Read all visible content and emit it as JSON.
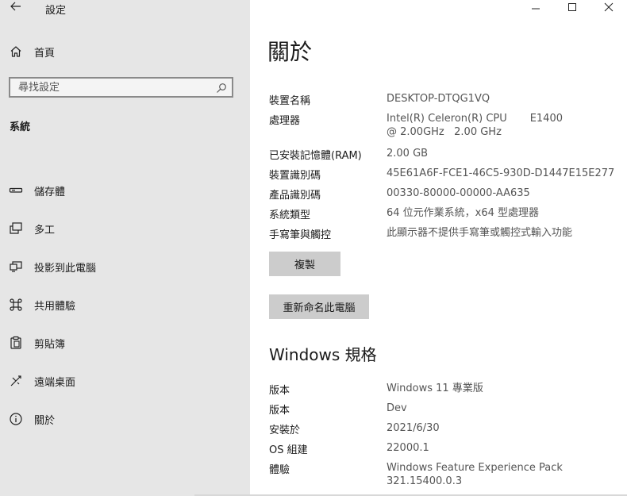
{
  "app": {
    "title": "設定"
  },
  "sidebar": {
    "home_label": "首頁",
    "search_placeholder": "尋找設定",
    "section_title": "系統",
    "items": [
      {
        "label": "儲存體",
        "icon": "storage-icon"
      },
      {
        "label": "多工",
        "icon": "multitasking-icon"
      },
      {
        "label": "投影到此電腦",
        "icon": "projecting-icon"
      },
      {
        "label": "共用體驗",
        "icon": "shared-experiences-icon"
      },
      {
        "label": "剪貼簿",
        "icon": "clipboard-icon"
      },
      {
        "label": "遠端桌面",
        "icon": "remote-desktop-icon"
      },
      {
        "label": "關於",
        "icon": "info-icon"
      }
    ]
  },
  "main": {
    "title": "關於",
    "device_specs": [
      {
        "label": "裝置名稱",
        "value": "DESKTOP-DTQG1VQ"
      },
      {
        "label": "處理器",
        "value": "Intel(R) Celeron(R) CPU       E1400  @ 2.00GHz   2.00 GHz"
      },
      {
        "label": "已安裝記憶體(RAM)",
        "value": "2.00 GB"
      },
      {
        "label": "裝置識別碼",
        "value": "45E61A6F-FCE1-46C5-930D-D1447E15E277"
      },
      {
        "label": "產品識別碼",
        "value": "00330-80000-00000-AA635"
      },
      {
        "label": "系統類型",
        "value": "64 位元作業系統，x64 型處理器"
      },
      {
        "label": "手寫筆與觸控",
        "value": "此顯示器不提供手寫筆或觸控式輸入功能"
      }
    ],
    "copy_button": "複製",
    "rename_button": "重新命名此電腦",
    "windows_spec_title": "Windows 規格",
    "windows_specs": [
      {
        "label": "版本",
        "value": "Windows 11 專業版"
      },
      {
        "label": "版本",
        "value": "Dev"
      },
      {
        "label": "安裝於",
        "value": "2021/6/30"
      },
      {
        "label": "OS 組建",
        "value": "22000.1"
      },
      {
        "label": "體驗",
        "value": "Windows Feature Experience Pack 321.15400.0.3"
      }
    ]
  }
}
